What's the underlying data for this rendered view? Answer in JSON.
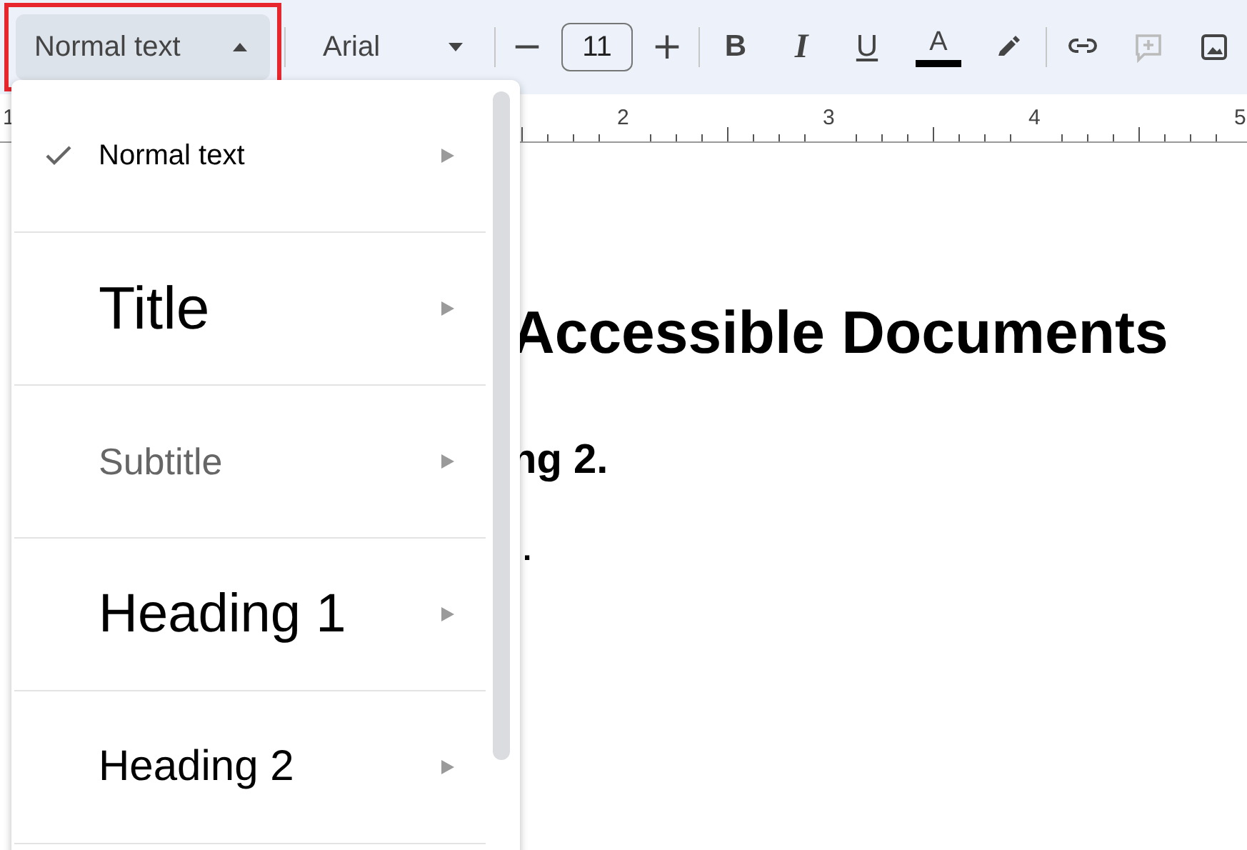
{
  "toolbar": {
    "style_dropdown": {
      "value": "Normal text",
      "expanded": true,
      "highlighted": true
    },
    "font_dropdown": {
      "value": "Arial"
    },
    "font_size": {
      "decrease": "−",
      "value": "11",
      "increase": "+"
    },
    "buttons": [
      {
        "kind": "bold",
        "label": "B"
      },
      {
        "kind": "italic",
        "label": "I"
      },
      {
        "kind": "underline",
        "label": "U"
      },
      {
        "kind": "text-color",
        "label": "A"
      },
      {
        "kind": "highlight"
      },
      {
        "kind": "link"
      },
      {
        "kind": "comment",
        "disabled": true
      },
      {
        "kind": "image"
      }
    ]
  },
  "ruler": {
    "numbers": [
      "1",
      "2",
      "3",
      "4",
      "5"
    ]
  },
  "document": {
    "lines": [
      {
        "kind": "title",
        "text": "Accessible Documents"
      },
      {
        "kind": "heading2",
        "text": "ng 2."
      },
      {
        "kind": "normal",
        "text": "."
      }
    ]
  },
  "style_menu": {
    "items": [
      {
        "kind": "normal",
        "label": "Normal text",
        "selected": true
      },
      {
        "kind": "title",
        "label": "Title",
        "selected": false
      },
      {
        "kind": "subtitle",
        "label": "Subtitle",
        "selected": false
      },
      {
        "kind": "heading1",
        "label": "Heading 1",
        "selected": false
      },
      {
        "kind": "heading2",
        "label": "Heading 2",
        "selected": false
      }
    ]
  }
}
